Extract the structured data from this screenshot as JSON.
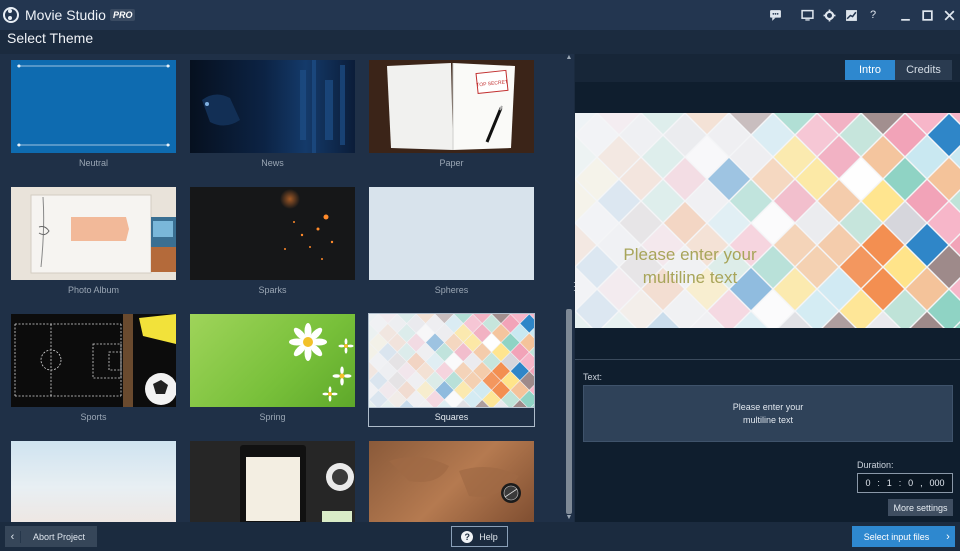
{
  "app": {
    "title": "Movie Studio",
    "badge": "PRO",
    "window_controls": [
      "feedback-icon",
      "monitor-icon",
      "gear-icon",
      "graph-icon",
      "help-icon",
      "minimize-icon",
      "maximize-icon",
      "close-icon"
    ]
  },
  "page": {
    "title": "Select Theme"
  },
  "themes": [
    {
      "label": "Neutral"
    },
    {
      "label": "News"
    },
    {
      "label": "Paper"
    },
    {
      "label": "Photo Album"
    },
    {
      "label": "Sparks"
    },
    {
      "label": "Spheres"
    },
    {
      "label": "Sports"
    },
    {
      "label": "Spring"
    },
    {
      "label": "Squares",
      "selected": true
    },
    {
      "label": ""
    },
    {
      "label": ""
    },
    {
      "label": ""
    }
  ],
  "paper_stamp": "TOP SECRET",
  "tabs": {
    "intro": "Intro",
    "credits": "Credits",
    "active": "Intro"
  },
  "preview": {
    "text": "Please enter your multiline text"
  },
  "text_section": {
    "label": "Text:",
    "value": "Please enter your\nmultiline text"
  },
  "duration": {
    "label": "Duration:",
    "hours": "0",
    "minutes": "1",
    "seconds": "0",
    "millis": "000"
  },
  "buttons": {
    "more_settings": "More settings",
    "abort": "Abort Project",
    "help": "Help",
    "select_input": "Select input files"
  },
  "colors": {
    "accent": "#2e88cf",
    "background": "#1b2b3f"
  }
}
